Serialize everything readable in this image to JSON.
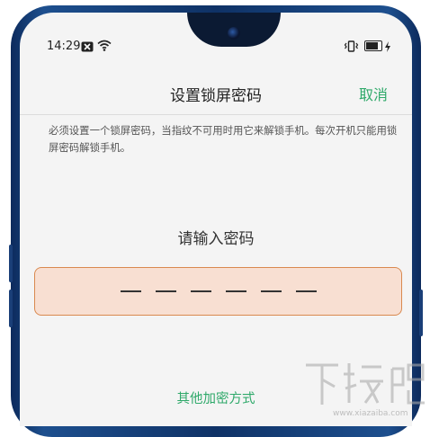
{
  "status_bar": {
    "time": "14:29",
    "icons": [
      "notification-x-icon",
      "wifi-icon",
      "vibrate-icon",
      "battery-icon",
      "charging-icon"
    ]
  },
  "header": {
    "title": "设置锁屏密码",
    "cancel_label": "取消"
  },
  "notice": "必须设置一个锁屏密码，当指纹不可用时用它来解锁手机。每次开机只能用锁屏密码解锁手机。",
  "pin_entry": {
    "prompt": "请输入密码",
    "length": 6,
    "entered": 0
  },
  "footer": {
    "other_method_label": "其他加密方式"
  },
  "watermark": {
    "text": "下载吧",
    "url": "www.xiazaiba.com"
  },
  "colors": {
    "accent_green": "#2fa96a",
    "pin_box_fill": "#f8dfd2",
    "pin_box_border": "#d9894f",
    "phone_frame": "#1d4f8e"
  }
}
